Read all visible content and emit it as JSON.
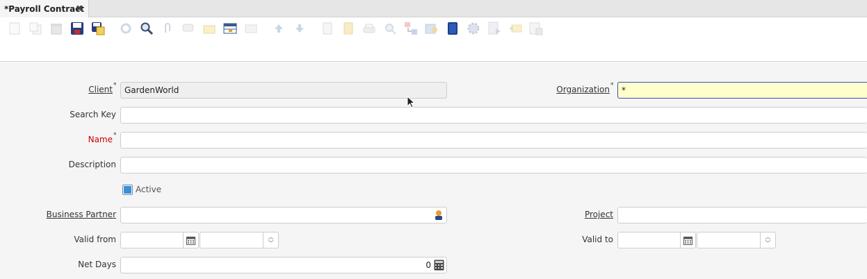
{
  "tab": {
    "title": "*Payroll Contract",
    "close_glyph": "✖"
  },
  "toolbar": {
    "icons": [
      "new-icon",
      "copy-icon",
      "delete-icon",
      "save-icon",
      "save-create-icon",
      "refresh-icon",
      "find-icon",
      "attachment-icon",
      "chat-icon",
      "archive-icon",
      "grid-toggle-icon",
      "parent-icon",
      "previous-record-icon",
      "next-record-icon",
      "report-icon",
      "archived-docs-icon",
      "print-icon",
      "zoom-across-icon",
      "active-workflows-icon",
      "request-icon",
      "product-info-icon",
      "process-icon",
      "export-icon",
      "import-icon",
      "post-it-icon",
      "customize-icon"
    ]
  },
  "form": {
    "client": {
      "label": "Client",
      "required": "*",
      "value": "GardenWorld"
    },
    "organization": {
      "label": "Organization",
      "required": "*",
      "value": "*"
    },
    "search_key": {
      "label": "Search Key",
      "value": ""
    },
    "name": {
      "label": "Name",
      "required": "*",
      "value": ""
    },
    "description": {
      "label": "Description",
      "value": ""
    },
    "active": {
      "label": "Active",
      "checked": true
    },
    "business_partner": {
      "label": "Business Partner",
      "value": ""
    },
    "project": {
      "label": "Project",
      "value": ""
    },
    "valid_from": {
      "label": "Valid from",
      "date": "",
      "time": ""
    },
    "valid_to": {
      "label": "Valid to",
      "date": "",
      "time": ""
    },
    "net_days": {
      "label": "Net Days",
      "value": "0"
    }
  }
}
